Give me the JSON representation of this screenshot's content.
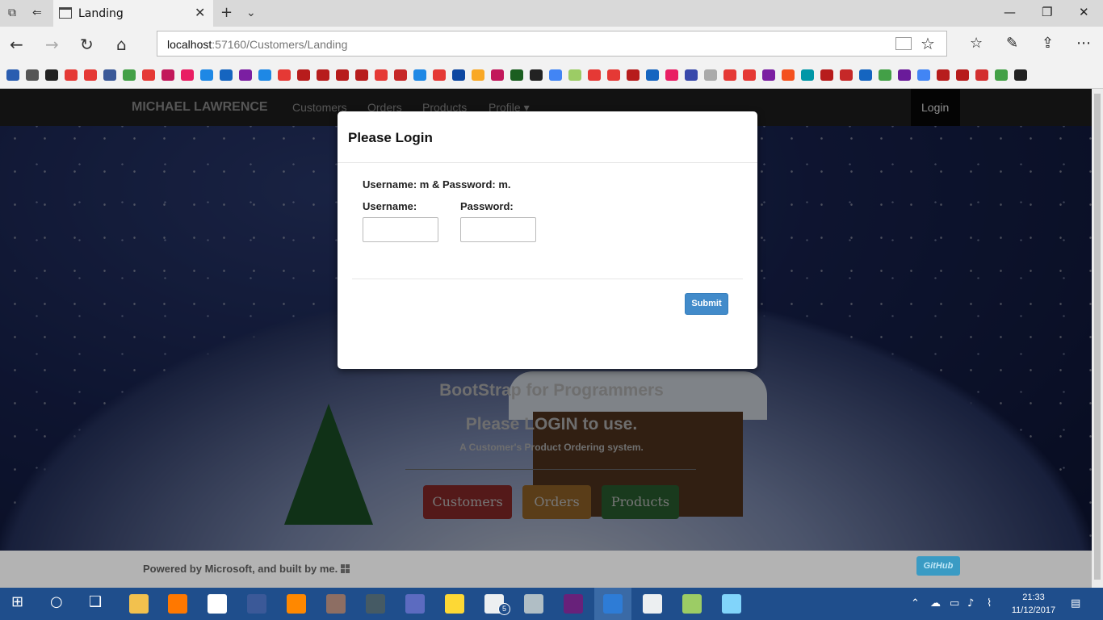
{
  "browser": {
    "tab_title": "Landing",
    "url_host": "localhost",
    "url_rest": ":57160/Customers/Landing",
    "icons": {
      "tab_set_aside": "tabs-icon",
      "close_tab": "close-icon",
      "new_tab": "plus-icon",
      "tab_menu": "chevron-down-icon",
      "minimize": "minimize-icon",
      "maximize": "maximize-icon",
      "close_window": "close-icon",
      "back": "arrow-left-icon",
      "forward": "arrow-right-icon",
      "refresh": "refresh-icon",
      "home": "home-icon",
      "reading_view": "book-icon",
      "favorite": "star-icon",
      "favorites_hub": "star-list-icon",
      "notes": "pen-icon",
      "share": "share-icon",
      "more": "more-icon"
    }
  },
  "site": {
    "brand": "MICHAEL LAWRENCE",
    "nav": [
      "Customers",
      "Orders",
      "Products",
      "Profile ▾"
    ],
    "login": "Login"
  },
  "hero": {
    "title": "BootStrap for Programmers",
    "subtitle": "Please LOGIN to use.",
    "tagline": "A Customer's Product Ordering system.",
    "buttons": [
      "Customers",
      "Orders",
      "Products"
    ]
  },
  "footer": {
    "powered": "Powered by Microsoft, and built by me.",
    "github": "GitHub"
  },
  "modal": {
    "title": "Please Login",
    "hint": "Username: m & Password: m.",
    "username_label": "Username:",
    "password_label": "Password:",
    "username_value": "",
    "password_value": "",
    "submit": "Submit"
  },
  "taskbar": {
    "time": "21:33",
    "date": "11/12/2017",
    "mail_badge": "5"
  },
  "colors": {
    "navbar": "#222222",
    "modal_submit": "#428bca",
    "hero_customers": "#9a2f2f",
    "hero_orders": "#a5702c",
    "hero_products": "#2f6a36",
    "taskbar": "#1f4e8c"
  }
}
